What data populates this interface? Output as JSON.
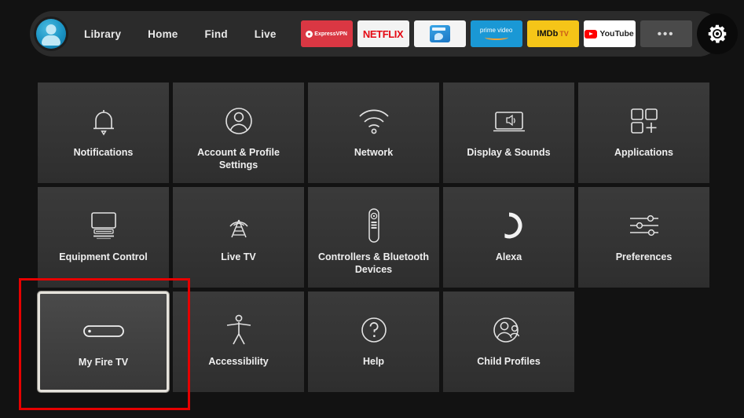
{
  "navbar": {
    "avatar_name": "profile-avatar",
    "links": [
      {
        "label": "Library"
      },
      {
        "label": "Home"
      },
      {
        "label": "Find"
      },
      {
        "label": "Live"
      }
    ],
    "apps": [
      {
        "name": "expressvpn",
        "label": "ExpressVPN"
      },
      {
        "name": "netflix",
        "label": "NETFLIX"
      },
      {
        "name": "file-manager",
        "label": ""
      },
      {
        "name": "prime-video",
        "label": "prime video"
      },
      {
        "name": "imdb-tv",
        "label": "IMDb",
        "label2": "TV"
      },
      {
        "name": "youtube",
        "label": "YouTube"
      },
      {
        "name": "more",
        "label": "•••"
      }
    ],
    "settings_button": "gear-icon"
  },
  "grid": {
    "rows": [
      [
        {
          "label": "Notifications",
          "icon": "bell-icon"
        },
        {
          "label": "Account & Profile Settings",
          "icon": "person-circle-icon"
        },
        {
          "label": "Network",
          "icon": "wifi-icon"
        },
        {
          "label": "Display & Sounds",
          "icon": "display-sound-icon"
        },
        {
          "label": "Applications",
          "icon": "app-grid-plus-icon"
        }
      ],
      [
        {
          "label": "Equipment Control",
          "icon": "tv-remote-icon"
        },
        {
          "label": "Live TV",
          "icon": "broadcast-tower-icon"
        },
        {
          "label": "Controllers & Bluetooth Devices",
          "icon": "remote-control-icon"
        },
        {
          "label": "Alexa",
          "icon": "alexa-ring-icon"
        },
        {
          "label": "Preferences",
          "icon": "sliders-icon"
        }
      ],
      [
        {
          "label": "My Fire TV",
          "icon": "fire-tv-stick-icon",
          "focused": true
        },
        {
          "label": "Accessibility",
          "icon": "accessibility-icon"
        },
        {
          "label": "Help",
          "icon": "question-circle-icon"
        },
        {
          "label": "Child Profiles",
          "icon": "child-profiles-icon"
        },
        {
          "label": "",
          "icon": "",
          "empty": true
        }
      ]
    ]
  },
  "annotation": {
    "color": "#e60000",
    "target": "My Fire TV"
  }
}
